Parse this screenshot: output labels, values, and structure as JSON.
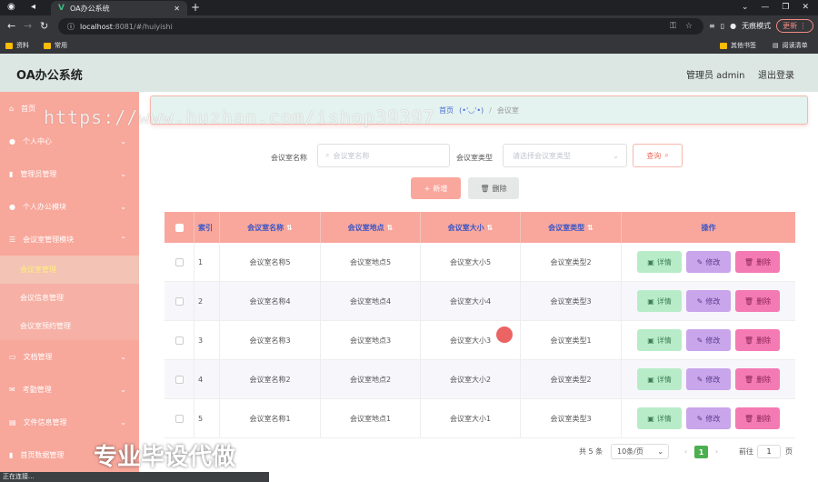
{
  "browser": {
    "tab_title": "OA办公系统",
    "url_host": "localhost",
    "url_path": ":8081/#/huiyishi",
    "incognito": "无痕模式",
    "update": "更新",
    "bookmarks": [
      "资料",
      "常用"
    ],
    "bookmarks_right": [
      "其他书签",
      "阅读清单"
    ]
  },
  "header": {
    "title": "OA办公系统",
    "admin": "管理员 admin",
    "logout": "退出登录"
  },
  "sidebar": {
    "items": [
      {
        "label": "首页",
        "icon": "home-icon"
      },
      {
        "label": "个人中心",
        "icon": "user-icon"
      },
      {
        "label": "管理员管理",
        "icon": "chart-icon"
      },
      {
        "label": "个人办公模块",
        "icon": "user-icon"
      },
      {
        "label": "会议室管理模块",
        "icon": "list-icon"
      }
    ],
    "submenu": [
      "会议室管理",
      "会议信息管理",
      "会议室预约管理"
    ],
    "items2": [
      {
        "label": "文档管理",
        "icon": "doc-icon"
      },
      {
        "label": "考勤管理",
        "icon": "mail-icon"
      },
      {
        "label": "文件信息管理",
        "icon": "file-icon"
      },
      {
        "label": "首页数据管理",
        "icon": "chart-icon"
      }
    ]
  },
  "breadcrumb": {
    "home": "首页",
    "emoji": "(•'◡'•)",
    "current": "会议室"
  },
  "search": {
    "name_label": "会议室名称",
    "name_placeholder": "会议室名称",
    "type_label": "会议室类型",
    "type_placeholder": "请选择会议室类型",
    "query": "查询"
  },
  "actions": {
    "add": "新增",
    "delete": "删除"
  },
  "table": {
    "headers": [
      "索引",
      "会议室名称",
      "会议室地点",
      "会议室大小",
      "会议室类型",
      "操作"
    ],
    "rows": [
      [
        "1",
        "会议室名称5",
        "会议室地点5",
        "会议室大小5",
        "会议室类型2"
      ],
      [
        "2",
        "会议室名称4",
        "会议室地点4",
        "会议室大小4",
        "会议室类型3"
      ],
      [
        "3",
        "会议室名称3",
        "会议室地点3",
        "会议室大小3",
        "会议室类型1"
      ],
      [
        "4",
        "会议室名称2",
        "会议室地点2",
        "会议室大小2",
        "会议室类型2"
      ],
      [
        "5",
        "会议室名称1",
        "会议室地点1",
        "会议室大小1",
        "会议室类型3"
      ]
    ],
    "row_buttons": {
      "detail": "详情",
      "edit": "修改",
      "delete": "删除"
    }
  },
  "pagination": {
    "total": "共 5 条",
    "page_size": "10条/页",
    "current": "1",
    "goto": "前往",
    "goto_value": "1",
    "page_unit": "页"
  },
  "watermark": {
    "url": "https://www.huzhan.com/ishop39397",
    "slogan": "专业毕设代做"
  },
  "status": "正在连接..."
}
